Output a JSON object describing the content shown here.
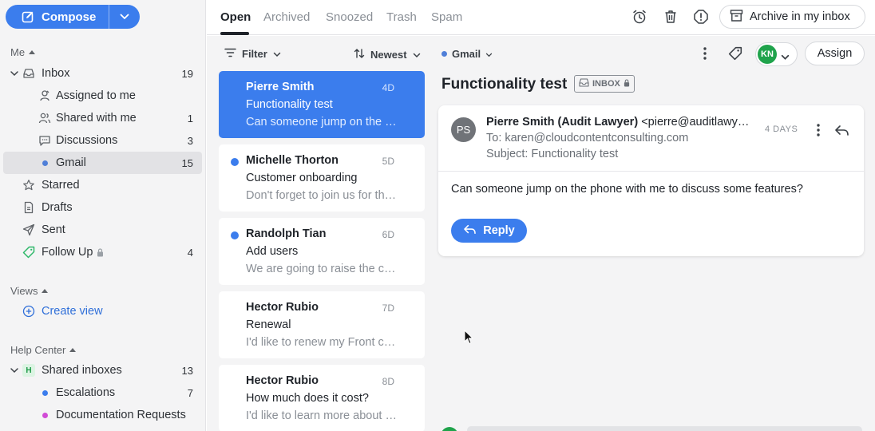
{
  "sidebar": {
    "compose_label": "Compose",
    "me_label": "Me",
    "items": [
      {
        "label": "Inbox",
        "count": "19"
      },
      {
        "label": "Assigned to me",
        "count": ""
      },
      {
        "label": "Shared with me",
        "count": "1"
      },
      {
        "label": "Discussions",
        "count": "3"
      },
      {
        "label": "Gmail",
        "count": "15"
      },
      {
        "label": "Starred",
        "count": ""
      },
      {
        "label": "Drafts",
        "count": ""
      },
      {
        "label": "Sent",
        "count": ""
      },
      {
        "label": "Follow Up",
        "count": "4"
      }
    ],
    "views_label": "Views",
    "create_view_label": "Create view",
    "help_center_label": "Help Center",
    "help_items": [
      {
        "label": "Shared inboxes",
        "count": "13",
        "badge": "H"
      },
      {
        "label": "Escalations",
        "count": "7"
      },
      {
        "label": "Documentation Requests",
        "count": ""
      }
    ]
  },
  "tabs": [
    "Open",
    "Archived",
    "Snoozed",
    "Trash",
    "Spam"
  ],
  "toolbar": {
    "archive_label": "Archive in my inbox"
  },
  "list": {
    "filter_label": "Filter",
    "sort_label": "Newest",
    "messages": [
      {
        "from": "Pierre Smith",
        "date": "4D",
        "subject": "Functionality test",
        "preview": "Can someone jump on the phone with me to discuss some features?"
      },
      {
        "from": "Michelle Thorton",
        "date": "5D",
        "subject": "Customer onboarding",
        "preview": "Don't forget to join us for the onboarding session"
      },
      {
        "from": "Randolph Tian",
        "date": "6D",
        "subject": "Add users",
        "preview": "We are going to raise the count of users"
      },
      {
        "from": "Hector Rubio",
        "date": "7D",
        "subject": "Renewal",
        "preview": "I'd like to renew my Front contract"
      },
      {
        "from": "Hector Rubio",
        "date": "8D",
        "subject": "How much does it cost?",
        "preview": "I'd like to learn more about pricing"
      }
    ]
  },
  "conversation": {
    "inbox_name": "Gmail",
    "assignee_initials": "KN",
    "assign_label": "Assign",
    "title": "Functionality test",
    "badge": "INBOX",
    "message": {
      "avatar_initials": "PS",
      "sender_name": "Pierre Smith (Audit Lawyer)",
      "sender_email": "<pierre@auditlawyer.com>",
      "to_line": "To: karen@cloudcontentconsulting.com",
      "subject_line": "Subject: Functionality test",
      "age": "4 DAYS",
      "body": "Can someone jump on the phone with me to discuss some features?",
      "reply_label": "Reply"
    }
  },
  "colors": {
    "accent": "#3b7ded",
    "gmail_dot": "#4f7fd8",
    "escalations_dot": "#3b7ded",
    "docs_dot": "#d14bd6",
    "followup_tag": "#2fb86b",
    "avatar_green": "#1fa34b"
  }
}
